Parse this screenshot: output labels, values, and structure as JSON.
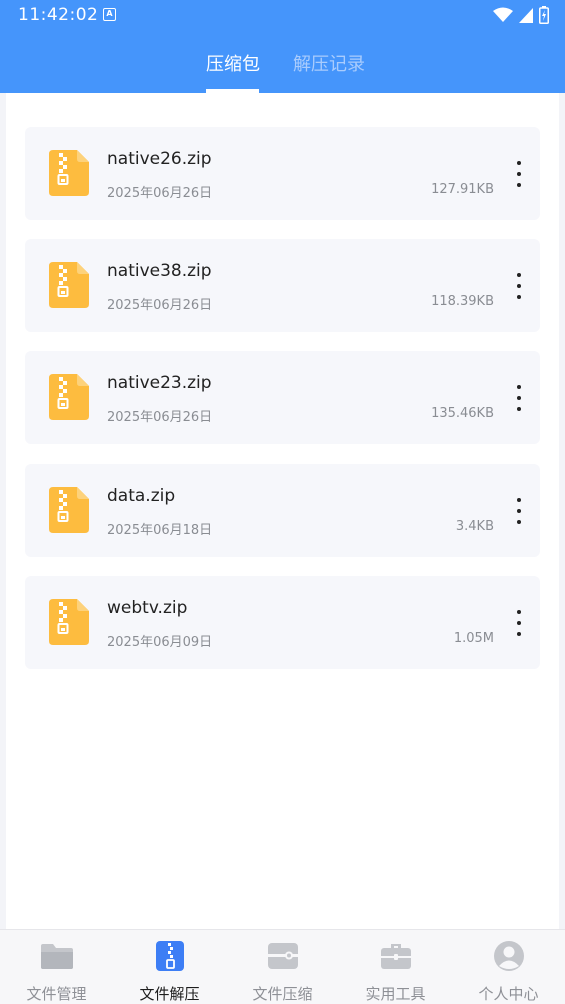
{
  "status_bar": {
    "time": "11:42:02",
    "notification_icon": "A"
  },
  "tabs": [
    {
      "label": "压缩包",
      "active": true
    },
    {
      "label": "解压记录",
      "active": false
    }
  ],
  "files": [
    {
      "name": "native26.zip",
      "date": "2025年06月26日",
      "size": "127.91KB"
    },
    {
      "name": "native38.zip",
      "date": "2025年06月26日",
      "size": "118.39KB"
    },
    {
      "name": "native23.zip",
      "date": "2025年06月26日",
      "size": "135.46KB"
    },
    {
      "name": "data.zip",
      "date": "2025年06月18日",
      "size": "3.4KB"
    },
    {
      "name": "webtv.zip",
      "date": "2025年06月09日",
      "size": "1.05M"
    }
  ],
  "bottom_nav": [
    {
      "label": "文件管理",
      "icon": "folder-icon",
      "active": false
    },
    {
      "label": "文件解压",
      "icon": "zip-file-icon",
      "active": true
    },
    {
      "label": "文件压缩",
      "icon": "compress-icon",
      "active": false
    },
    {
      "label": "实用工具",
      "icon": "toolbox-icon",
      "active": false
    },
    {
      "label": "个人中心",
      "icon": "person-icon",
      "active": false
    }
  ],
  "colors": {
    "header": "#4595fb",
    "file_icon": "#fdbc3f",
    "active_nav": "#3d7ef5",
    "inactive_nav": "#c4c6cb"
  }
}
